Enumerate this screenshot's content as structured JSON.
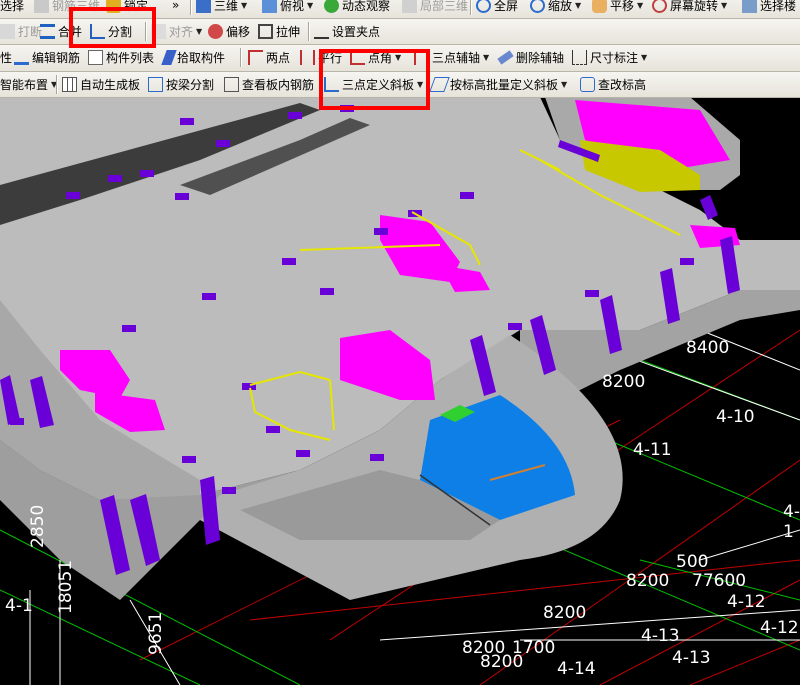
{
  "toolbar1": {
    "select_label": "选择",
    "rebar3d_label": "钢筋三维",
    "lock_label": "锁定",
    "more_label": "»",
    "view3d_label": "三维",
    "topview_label": "俯视",
    "dynamic_label": "动态观察",
    "local3d_label": "局部三维",
    "fullscreen_label": "全屏",
    "zoom_label": "缩放",
    "pan_label": "平移",
    "rotate_label": "屏幕旋转",
    "selectlayer_label": "选择楼"
  },
  "toolbar_edit": {
    "break_label": "打断",
    "merge_label": "合并",
    "split_label": "分割",
    "align_label": "对齐",
    "offset_label": "偏移",
    "stretch_label": "拉伸",
    "grip_label": "设置夹点"
  },
  "toolbar2": {
    "attr_label": "性",
    "edit_rebar_label": "编辑钢筋",
    "component_list_label": "构件列表",
    "pick_component_label": "拾取构件",
    "two_point_label": "两点",
    "parallel_label": "平行",
    "point_angle_label": "点角",
    "three_point_axis_label": "三点辅轴",
    "delete_axis_label": "删除辅轴",
    "dimension_label": "尺寸标注"
  },
  "toolbar3": {
    "smart_layout_label": "智能布置",
    "auto_slab_label": "自动生成板",
    "beam_split_label": "按梁分割",
    "view_slab_rebar_label": "查看板内钢筋",
    "three_point_slope_label": "三点定义斜板",
    "batch_slope_label": "按标高批量定义斜板",
    "check_elevation_label": "查改标高"
  },
  "dimensions": [
    "8400",
    "8200",
    "500",
    "8200",
    "77600",
    "8200",
    "8200",
    "1700",
    "8200",
    "2850",
    "18051",
    "9651"
  ],
  "axis_labels": [
    "4-10",
    "4-11",
    "4-1",
    "4-12",
    "4-12",
    "4-13",
    "4-13",
    "4-14",
    "4-1"
  ],
  "colors": {
    "highlight_box": "#ff0000",
    "slab": "#bdbdbd",
    "magenta": "#ff00ff",
    "purple": "#6a00d8",
    "blue": "#0a78e6",
    "yellow": "#e6e600"
  }
}
